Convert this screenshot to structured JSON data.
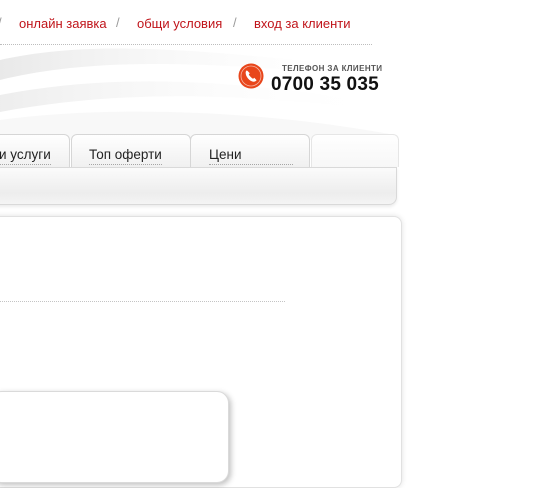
{
  "top_nav": {
    "items": [
      {
        "label": "онлайн заявка"
      },
      {
        "label": "общи условия"
      },
      {
        "label": "вход за клиенти"
      }
    ],
    "separator": "/"
  },
  "phone": {
    "label": "ТЕЛЕФОН ЗА КЛИЕНТИ",
    "number": "0700 35 035",
    "icon": "phone-icon",
    "accent_color": "#e8461b"
  },
  "tabs": [
    {
      "label": "и услуги"
    },
    {
      "label": "Топ оферти"
    },
    {
      "label": "Цени"
    },
    {
      "label": ""
    }
  ],
  "colors": {
    "link": "#c0141a",
    "accent": "#e8461b"
  }
}
